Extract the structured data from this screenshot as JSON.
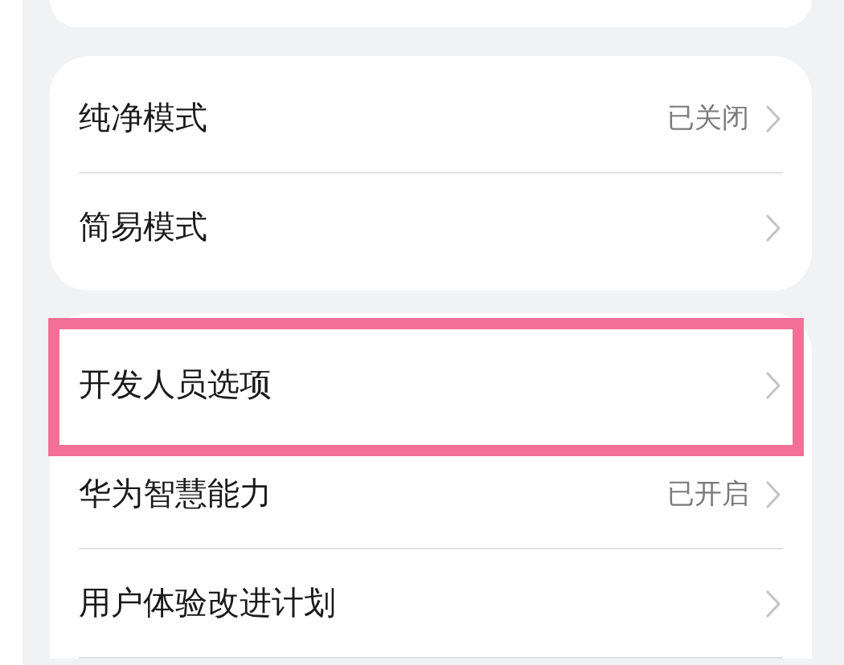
{
  "groups": [
    {
      "items": [
        {
          "label": "纯净模式",
          "value": "已关闭",
          "highlighted": false
        },
        {
          "label": "简易模式",
          "highlighted": false
        }
      ]
    },
    {
      "items": [
        {
          "label": "开发人员选项",
          "highlighted": true
        },
        {
          "label": "华为智慧能力",
          "value": "已开启",
          "highlighted": false
        },
        {
          "label": "用户体验改进计划",
          "highlighted": false
        }
      ]
    }
  ]
}
